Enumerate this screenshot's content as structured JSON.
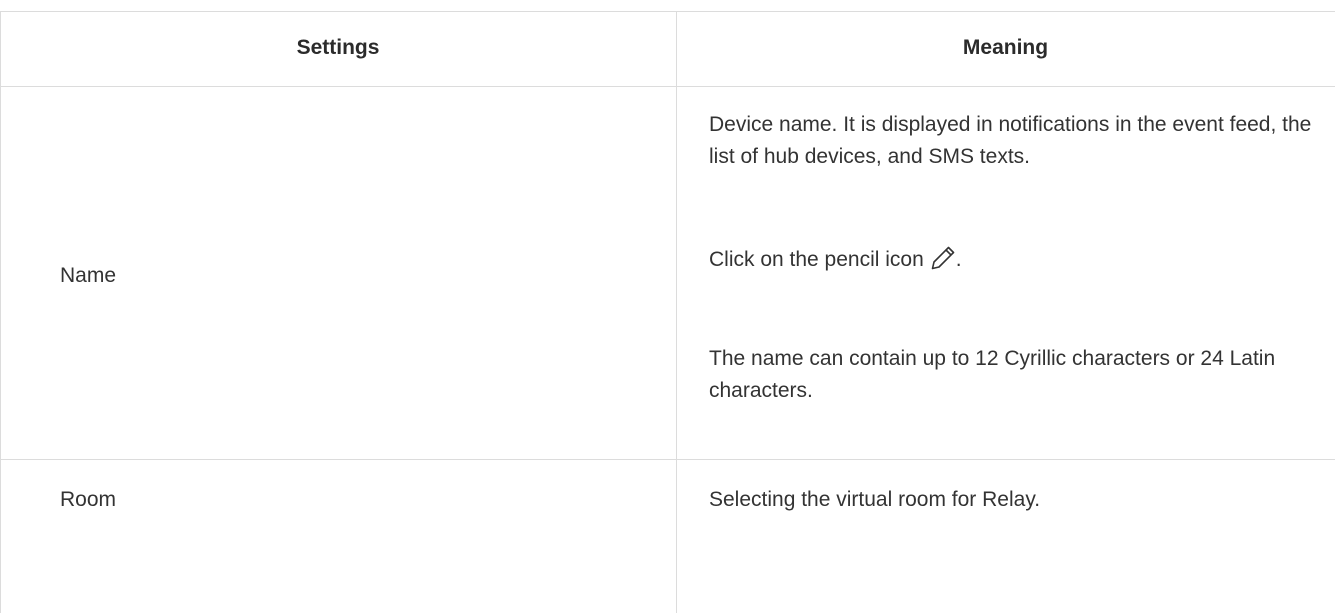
{
  "table": {
    "headers": {
      "settings": "Settings",
      "meaning": "Meaning"
    },
    "rows": [
      {
        "setting": "Name",
        "meaning": [
          "Device name. It is displayed in notifications in the event feed, the list of hub devices, and SMS texts.",
          "Click on the pencil icon",
          "The name can contain up to 12 Cyrillic characters or 24 Latin characters."
        ],
        "icon": "pencil-icon",
        "after_icon": "."
      },
      {
        "setting": "Room",
        "meaning": [
          "Selecting the virtual room for Relay."
        ]
      }
    ]
  }
}
